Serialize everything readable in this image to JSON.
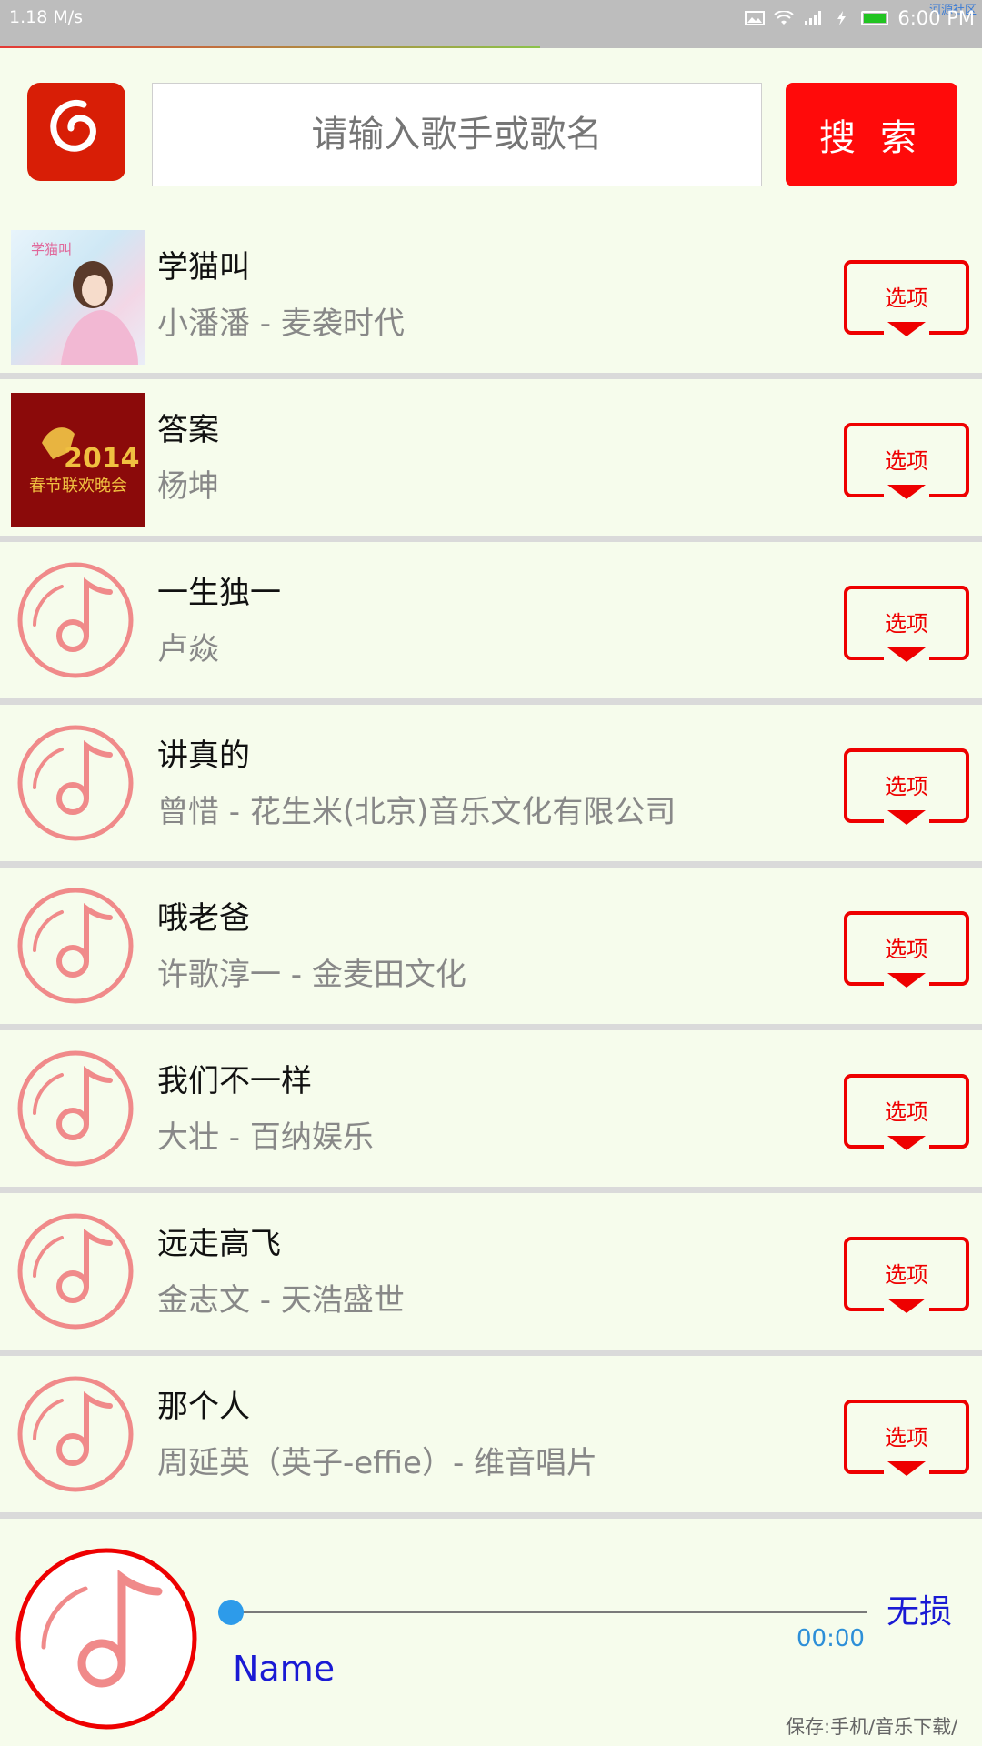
{
  "status": {
    "speed": "1.18 M/s",
    "time": "6:00 PM",
    "watermark": "河源社区"
  },
  "search": {
    "placeholder": "请输入歌手或歌名",
    "button_label": "搜 索"
  },
  "songs": [
    {
      "title": "学猫叫",
      "subtitle": "小潘潘 - 麦袭时代",
      "cover": "album-art",
      "cover_text": "学猫叫",
      "option": "选项"
    },
    {
      "title": "答案",
      "subtitle": "杨坤",
      "cover": "album-art",
      "cover_text": "2014 春节联欢晚会",
      "option": "选项"
    },
    {
      "title": "一生独一",
      "subtitle": "卢焱",
      "cover": "music-note-icon",
      "option": "选项"
    },
    {
      "title": "讲真的",
      "subtitle": "曾惜 - 花生米(北京)音乐文化有限公司",
      "cover": "music-note-icon",
      "option": "选项"
    },
    {
      "title": "哦老爸",
      "subtitle": "许歌淳一 - 金麦田文化",
      "cover": "music-note-icon",
      "option": "选项"
    },
    {
      "title": "我们不一样",
      "subtitle": "大壮 - 百纳娱乐",
      "cover": "music-note-icon",
      "option": "选项"
    },
    {
      "title": "远走高飞",
      "subtitle": "金志文 - 天浩盛世",
      "cover": "music-note-icon",
      "option": "选项"
    },
    {
      "title": "那个人",
      "subtitle": "周延英（英子-effie）- 维音唱片",
      "cover": "music-note-icon",
      "option": "选项"
    }
  ],
  "player": {
    "name": "Name",
    "time": "00:00",
    "quality": "无损",
    "save_info": "保存:手机/音乐下载/",
    "progress": 0
  },
  "colors": {
    "accent": "#ff0a0a",
    "note_icon": "#f08a8a",
    "background": "#f6fcec"
  }
}
